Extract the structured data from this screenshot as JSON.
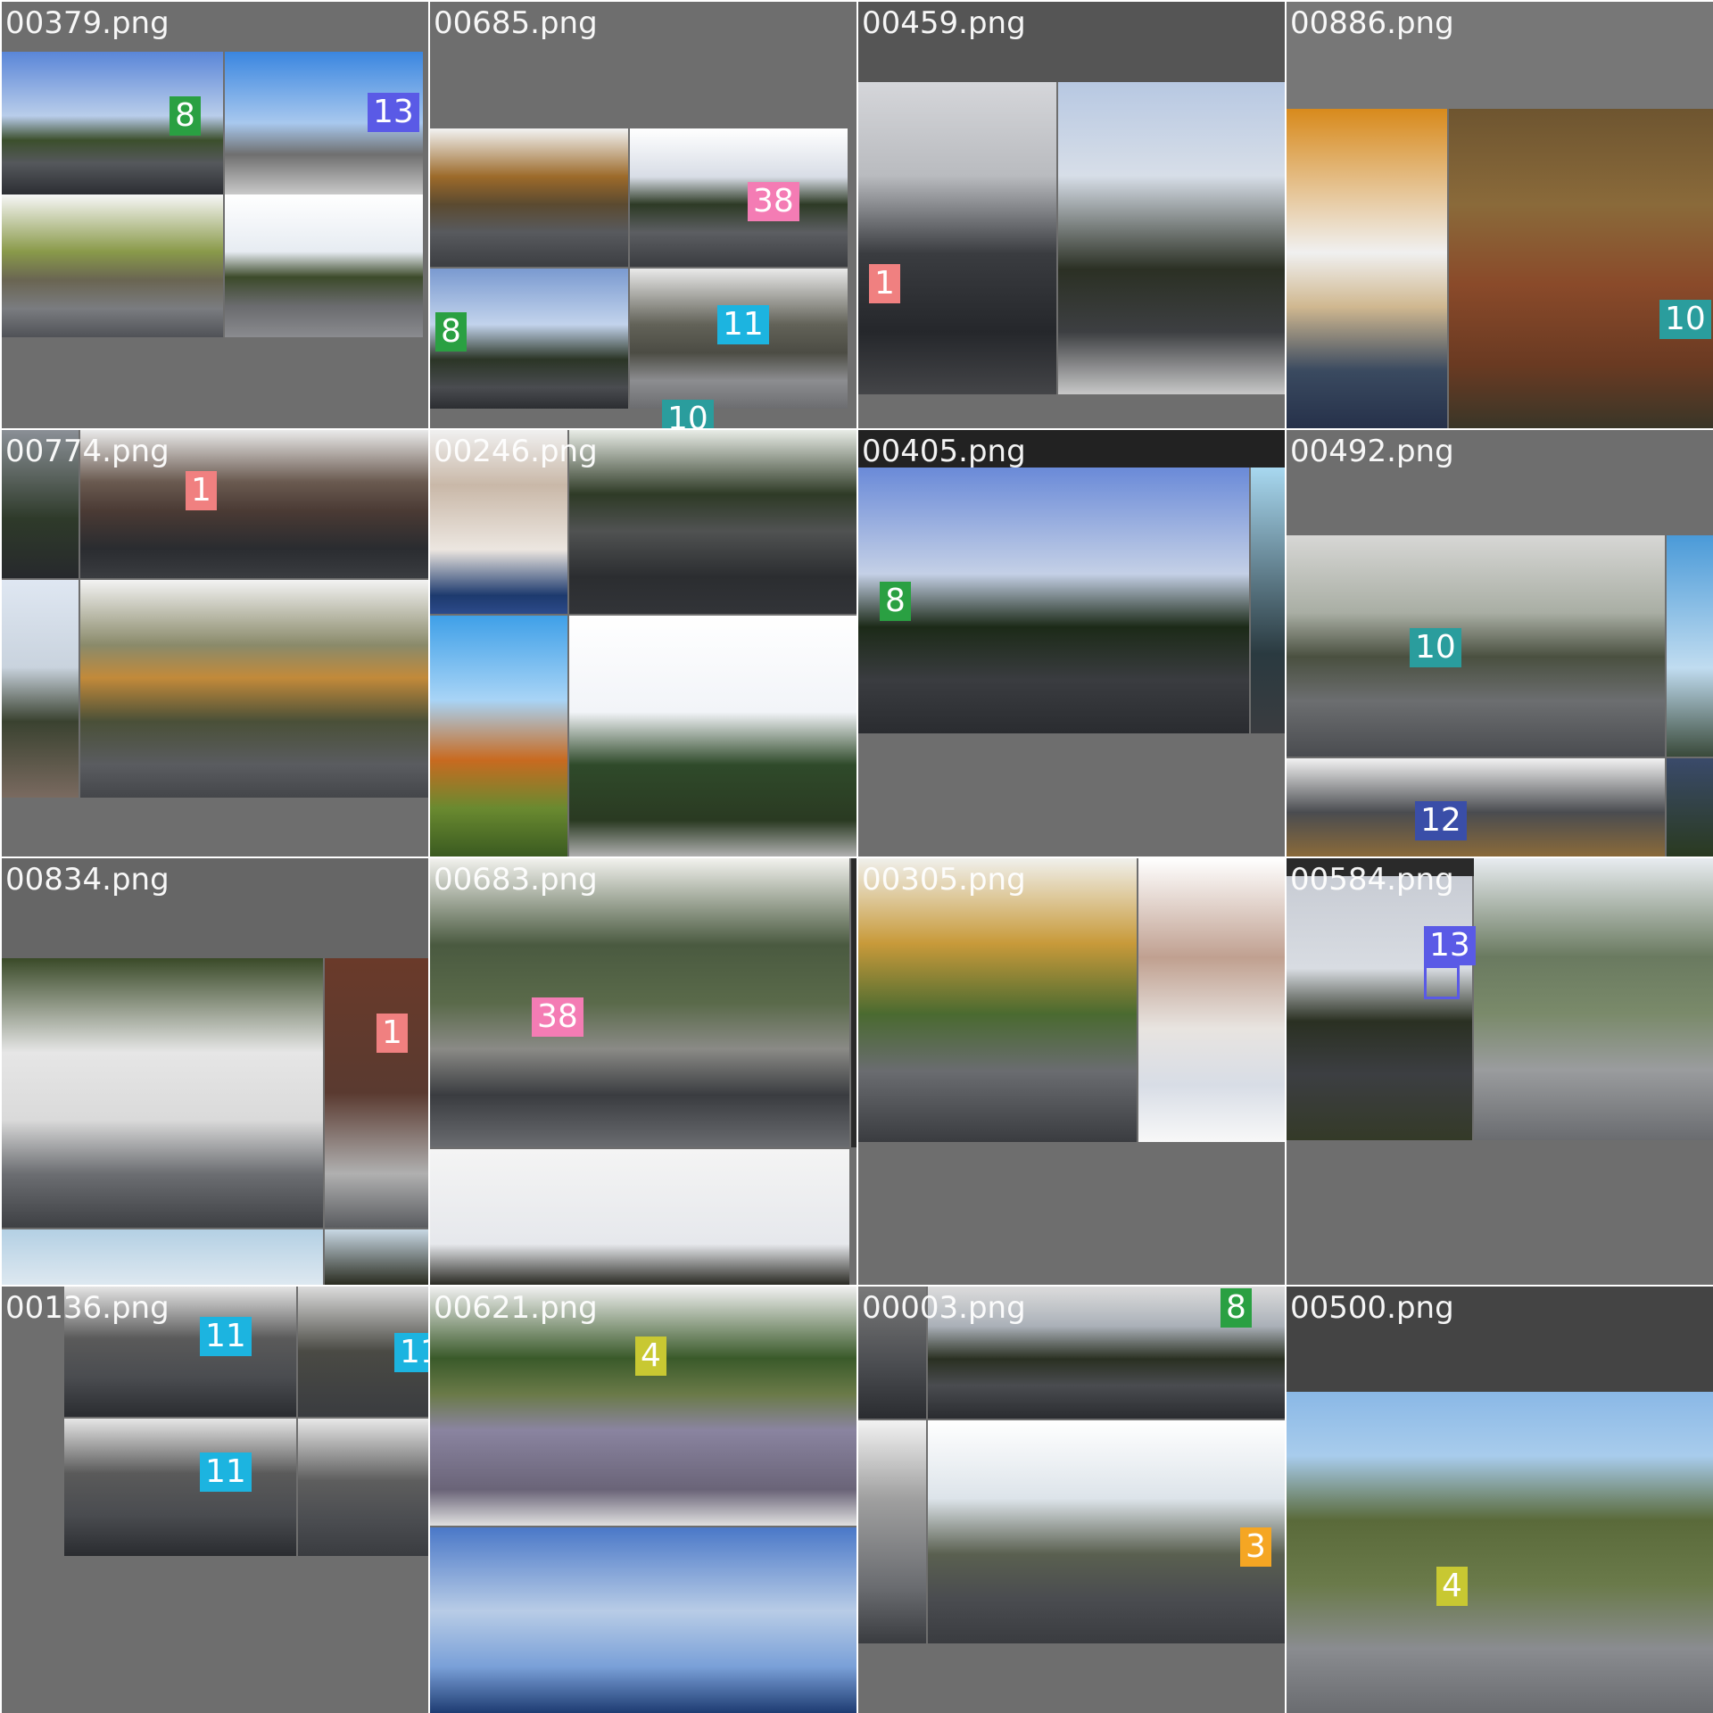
{
  "cells": [
    {
      "filename": "00379.png",
      "labels": [
        "8",
        "13"
      ]
    },
    {
      "filename": "00685.png",
      "labels": [
        "38",
        "8",
        "11",
        "10"
      ]
    },
    {
      "filename": "00459.png",
      "labels": [
        "1"
      ]
    },
    {
      "filename": "00886.png",
      "labels": [
        "10"
      ]
    },
    {
      "filename": "00774.png",
      "labels": [
        "1"
      ]
    },
    {
      "filename": "00246.png",
      "labels": []
    },
    {
      "filename": "00405.png",
      "labels": [
        "8"
      ]
    },
    {
      "filename": "00492.png",
      "labels": [
        "10",
        "12"
      ]
    },
    {
      "filename": "00834.png",
      "labels": [
        "1"
      ]
    },
    {
      "filename": "00683.png",
      "labels": [
        "38"
      ]
    },
    {
      "filename": "00305.png",
      "labels": []
    },
    {
      "filename": "00584.png",
      "labels": [
        "13"
      ]
    },
    {
      "filename": "00136.png",
      "labels": [
        "11",
        "11",
        "11"
      ]
    },
    {
      "filename": "00621.png",
      "labels": [
        "4"
      ]
    },
    {
      "filename": "00003.png",
      "labels": [
        "8",
        "3"
      ]
    },
    {
      "filename": "00500.png",
      "labels": [
        "4"
      ]
    }
  ],
  "label_colors": {
    "1": "#f08080",
    "3": "#f5a623",
    "4": "#c8c832",
    "8": "#2aa042",
    "10": "#2a9d9d",
    "11": "#1cb4e0",
    "12": "#3a4ea8",
    "13": "#5a5ae6",
    "38": "#f47cb4"
  }
}
